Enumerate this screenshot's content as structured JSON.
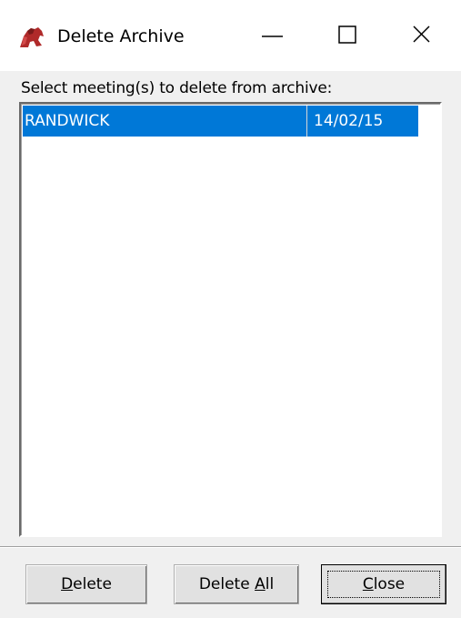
{
  "window": {
    "title": "Delete Archive",
    "icon": "red-horse-app-icon"
  },
  "titlebar_buttons": {
    "minimize": "minimize-icon",
    "maximize": "maximize-icon",
    "close": "close-icon"
  },
  "dialog": {
    "prompt": "Select meeting(s) to delete from archive:"
  },
  "meetings": [
    {
      "name": "RANDWICK",
      "date": "14/02/15",
      "selected": true
    }
  ],
  "buttons": {
    "delete": {
      "pre": "",
      "accel": "D",
      "post": "elete"
    },
    "delete_all": {
      "pre": "Delete ",
      "accel": "A",
      "post": "ll"
    },
    "close": {
      "pre": "",
      "accel": "C",
      "post": "lose"
    }
  },
  "colors": {
    "selection": "#0078d7",
    "dialog_bg": "#f0f0f0"
  }
}
